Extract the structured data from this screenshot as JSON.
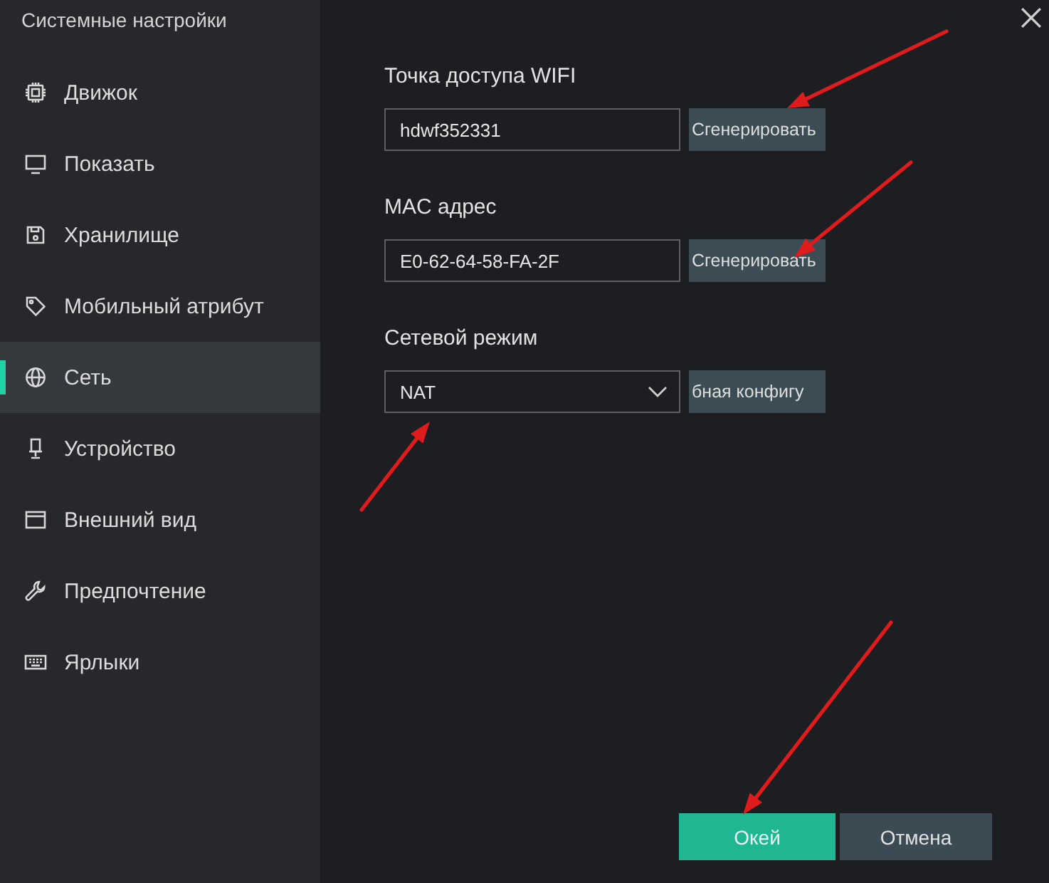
{
  "window": {
    "title": "Системные настройки"
  },
  "sidebar": {
    "items": [
      {
        "label": "Движок",
        "selected": false
      },
      {
        "label": "Показать",
        "selected": false
      },
      {
        "label": "Хранилище",
        "selected": false
      },
      {
        "label": "Мобильный атрибут",
        "selected": false
      },
      {
        "label": "Сеть",
        "selected": true
      },
      {
        "label": "Устройство",
        "selected": false
      },
      {
        "label": "Внешний вид",
        "selected": false
      },
      {
        "label": "Предпочтение",
        "selected": false
      },
      {
        "label": "Ярлыки",
        "selected": false
      }
    ]
  },
  "form": {
    "fields": [
      {
        "label": "Точка доступа WIFI",
        "kind": "input",
        "value": "hdwf352331",
        "button": "Сгенерировать"
      },
      {
        "label": "MAC адрес",
        "kind": "input",
        "value": "E0-62-64-58-FA-2F",
        "button": "Сгенерировать"
      },
      {
        "label": "Сетевой режим",
        "kind": "select",
        "value": "NAT",
        "button": "бная конфигу"
      }
    ]
  },
  "footer": {
    "buttons": [
      {
        "label": "Окей",
        "kind": "primary"
      },
      {
        "label": "Отмена",
        "kind": "secondary"
      }
    ]
  }
}
